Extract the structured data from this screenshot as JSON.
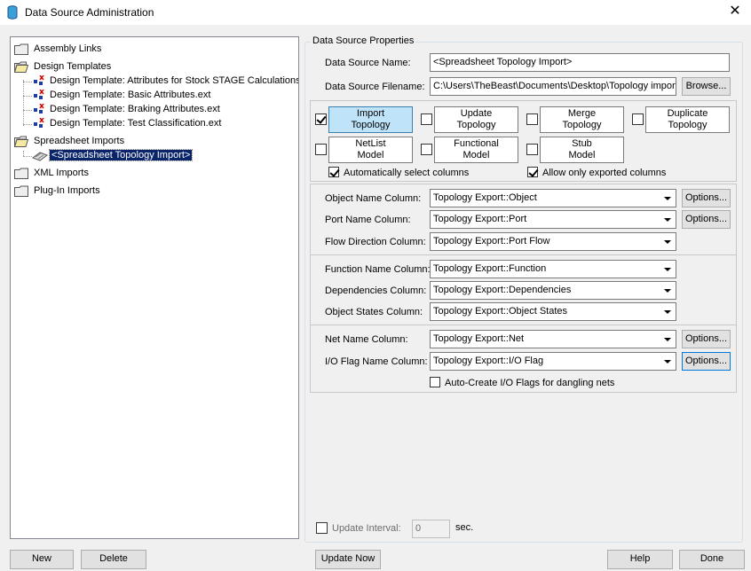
{
  "window": {
    "title": "Data Source Administration"
  },
  "tree": {
    "items": [
      {
        "label": "Assembly Links"
      },
      {
        "label": "Design Templates"
      },
      {
        "label": "Design Template: Attributes for Stock STAGE Calculations.ext"
      },
      {
        "label": "Design Template: Basic Attributes.ext"
      },
      {
        "label": "Design Template: Braking Attributes.ext"
      },
      {
        "label": "Design Template: Test Classification.ext"
      },
      {
        "label": "Spreadsheet Imports"
      },
      {
        "label": "<Spreadsheet Topology Import>"
      },
      {
        "label": "XML Imports"
      },
      {
        "label": "Plug-In Imports"
      }
    ]
  },
  "props": {
    "group_title": "Data Source Properties",
    "name_label": "Data Source Name:",
    "name_value": "<Spreadsheet Topology Import>",
    "filename_label": "Data Source Filename:",
    "filename_value": "C:\\Users\\TheBeast\\Documents\\Desktop\\Topology import",
    "browse": "Browse...",
    "modes": [
      {
        "line1": "Import",
        "line2": "Topology",
        "checked": true
      },
      {
        "line1": "Update",
        "line2": "Topology",
        "checked": false
      },
      {
        "line1": "Merge",
        "line2": "Topology",
        "checked": false
      },
      {
        "line1": "Duplicate",
        "line2": "Topology",
        "checked": false
      },
      {
        "line1": "NetList",
        "line2": "Model",
        "checked": false
      },
      {
        "line1": "Functional",
        "line2": "Model",
        "checked": false
      },
      {
        "line1": "Stub",
        "line2": "Model",
        "checked": false
      }
    ],
    "auto_select": "Automatically select columns",
    "only_exported": "Allow only exported columns",
    "object_name_label": "Object Name Column:",
    "object_name_value": "Topology Export::Object",
    "port_name_label": "Port Name Column:",
    "port_name_value": "Topology Export::Port",
    "flow_dir_label": "Flow Direction Column:",
    "flow_dir_value": "Topology Export::Port Flow",
    "function_name_label": "Function Name Column:",
    "function_name_value": "Topology Export::Function",
    "dependencies_label": "Dependencies Column:",
    "dependencies_value": "Topology Export::Dependencies",
    "object_states_label": "Object States Column:",
    "object_states_value": "Topology Export::Object States",
    "net_name_label": "Net Name Column:",
    "net_name_value": "Topology Export::Net",
    "io_flag_label": "I/O Flag Name Column:",
    "io_flag_value": "Topology Export::I/O Flag",
    "auto_create": "Auto-Create I/O Flags for dangling nets",
    "options": "Options...",
    "update_interval_label": "Update Interval:",
    "update_interval_value": "0",
    "sec": "sec."
  },
  "buttons": {
    "new": "New",
    "delete": "Delete",
    "update_now": "Update Now",
    "help": "Help",
    "done": "Done"
  },
  "colors": {
    "selection": "#0a246a",
    "active_mode": "#bfe4f9"
  }
}
